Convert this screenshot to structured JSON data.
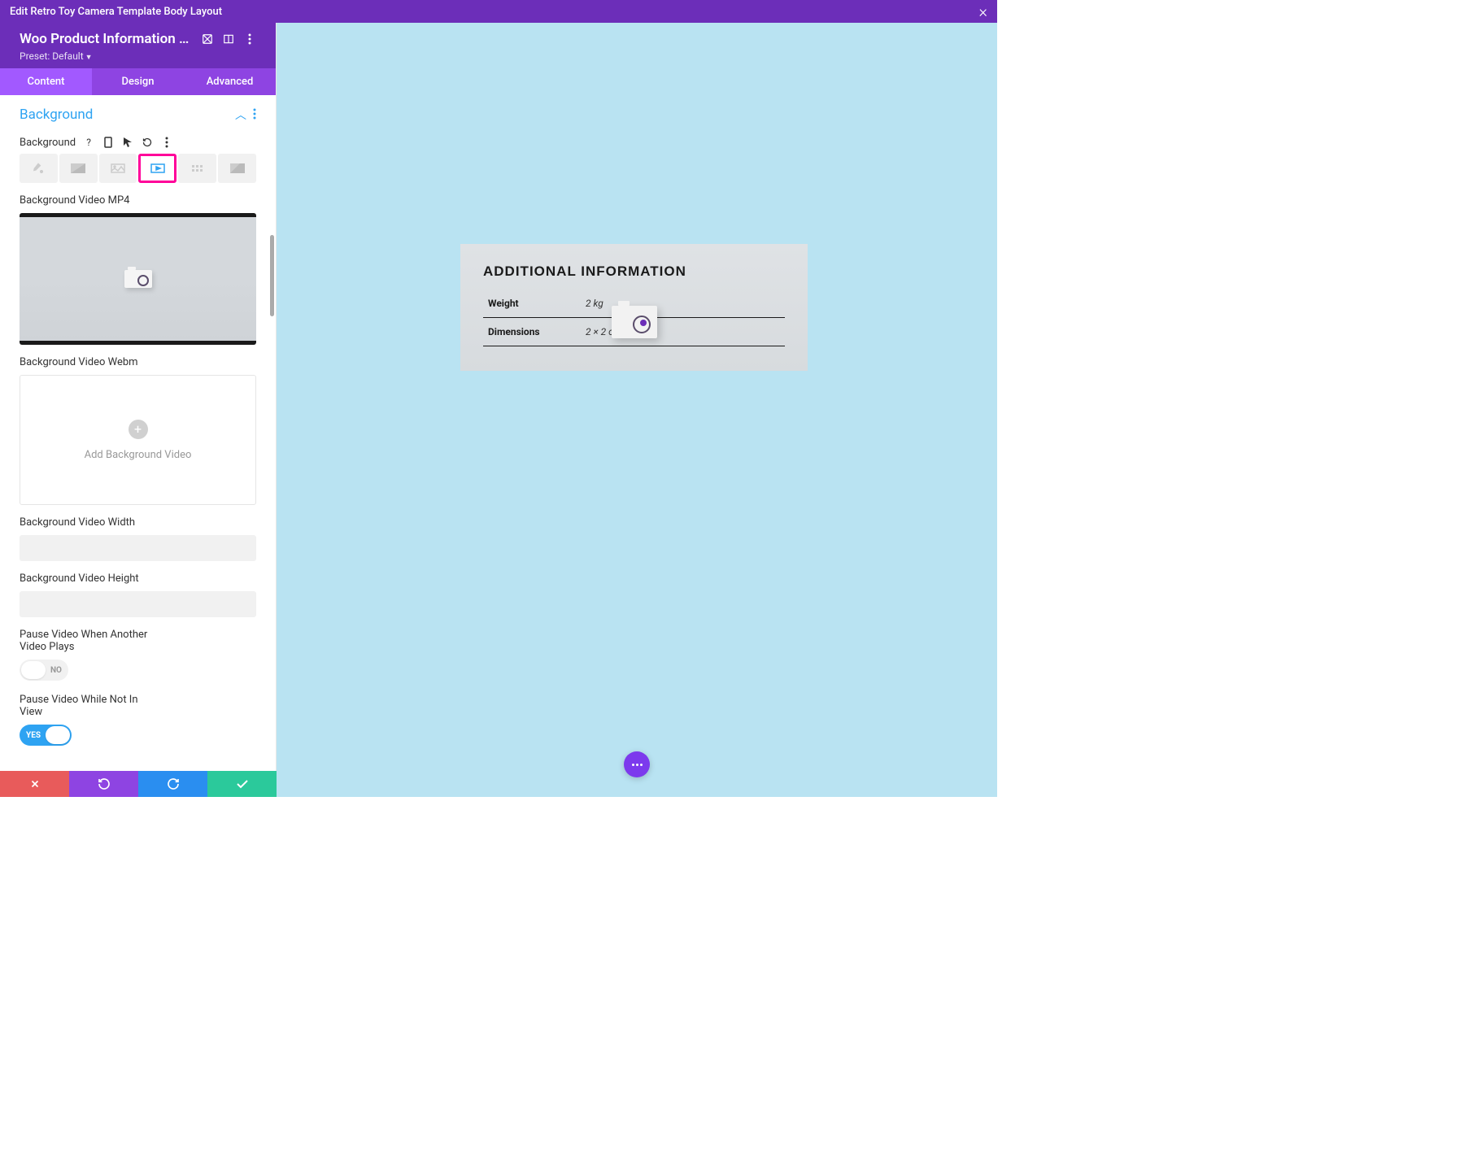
{
  "topbar": {
    "title": "Edit Retro Toy Camera Template Body Layout"
  },
  "module": {
    "title": "Woo Product Information S...",
    "preset_label": "Preset: Default"
  },
  "tabs": {
    "content": "Content",
    "design": "Design",
    "advanced": "Advanced"
  },
  "panel": {
    "title": "Background"
  },
  "settings": {
    "background_label": "Background",
    "bg_video_mp4_label": "Background Video MP4",
    "bg_video_webm_label": "Background Video Webm",
    "add_bg_video_text": "Add Background Video",
    "bg_video_width_label": "Background Video Width",
    "bg_video_width_value": "",
    "bg_video_height_label": "Background Video Height",
    "bg_video_height_value": "",
    "pause_another_label": "Pause Video When Another Video Plays",
    "pause_another_value": "NO",
    "pause_notinview_label": "Pause Video While Not In View",
    "pause_notinview_value": "YES"
  },
  "preview": {
    "info_title": "ADDITIONAL INFORMATION",
    "rows": [
      {
        "key": "Weight",
        "val": "2 kg"
      },
      {
        "key": "Dimensions",
        "val": "2 × 2 cm"
      }
    ]
  },
  "colors": {
    "accent_purple": "#6c2eb9",
    "accent_blue": "#2ea3f2",
    "highlight_pink": "#ff0099"
  }
}
